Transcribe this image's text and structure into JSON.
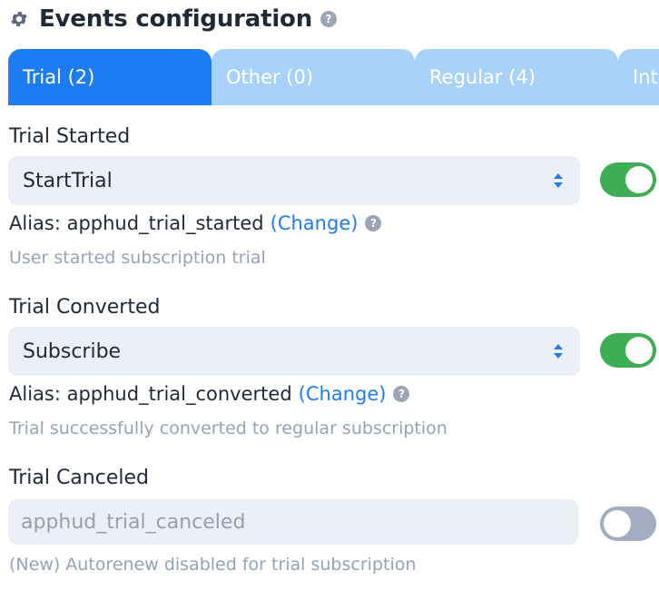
{
  "header": {
    "title": "Events configuration",
    "help_icon": "?"
  },
  "tabs": [
    {
      "label": "Trial (2)",
      "active": true
    },
    {
      "label": "Other (0)",
      "active": false
    },
    {
      "label": "Regular (4)",
      "active": false
    },
    {
      "label": "Int",
      "active": false
    }
  ],
  "events": [
    {
      "label": "Trial Started",
      "select_value": "StartTrial",
      "alias_prefix": "Alias: apphud_trial_started",
      "change_label": "(Change)",
      "help": "?",
      "description": "User started subscription trial",
      "enabled": true
    },
    {
      "label": "Trial Converted",
      "select_value": "Subscribe",
      "alias_prefix": "Alias: apphud_trial_converted",
      "change_label": "(Change)",
      "help": "?",
      "description": "Trial successfully converted to regular subscription",
      "enabled": true
    },
    {
      "label": "Trial Canceled",
      "input_placeholder": "apphud_trial_canceled",
      "description": "(New) Autorenew disabled for trial subscription",
      "enabled": false
    }
  ],
  "colors": {
    "accent": "#1d7cf2",
    "tab_inactive": "#a9d2fb",
    "toggle_on": "#3dae54",
    "toggle_off": "#a2aec0"
  },
  "icons": {
    "header": "gear-icon",
    "help": "question-icon",
    "select": "sort-arrows-icon"
  }
}
